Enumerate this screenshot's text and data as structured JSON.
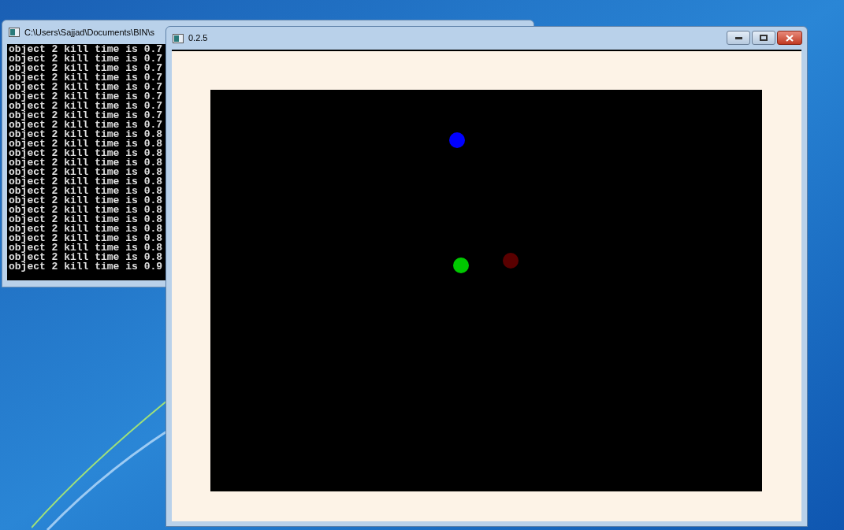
{
  "console_window": {
    "title": "C:\\Users\\Sajjad\\Documents\\BIN\\s",
    "lines": [
      "object 2 kill time is 0.7",
      "object 2 kill time is 0.7",
      "object 2 kill time is 0.7",
      "object 2 kill time is 0.7",
      "object 2 kill time is 0.7",
      "object 2 kill time is 0.7",
      "object 2 kill time is 0.7",
      "object 2 kill time is 0.7",
      "object 2 kill time is 0.7",
      "object 2 kill time is 0.8",
      "object 2 kill time is 0.8",
      "object 2 kill time is 0.8",
      "object 2 kill time is 0.8",
      "object 2 kill time is 0.8",
      "object 2 kill time is 0.8",
      "object 2 kill time is 0.8",
      "object 2 kill time is 0.8",
      "object 2 kill time is 0.8",
      "object 2 kill time is 0.8",
      "object 2 kill time is 0.8",
      "object 2 kill time is 0.8",
      "object 2 kill time is 0.8",
      "object 2 kill time is 0.8",
      "object 2 kill time is 0.9"
    ]
  },
  "game_window": {
    "title": "0.2.5",
    "dots": [
      {
        "color": "#0000ff"
      },
      {
        "color": "#00c800"
      },
      {
        "color": "#5a0000"
      }
    ]
  }
}
